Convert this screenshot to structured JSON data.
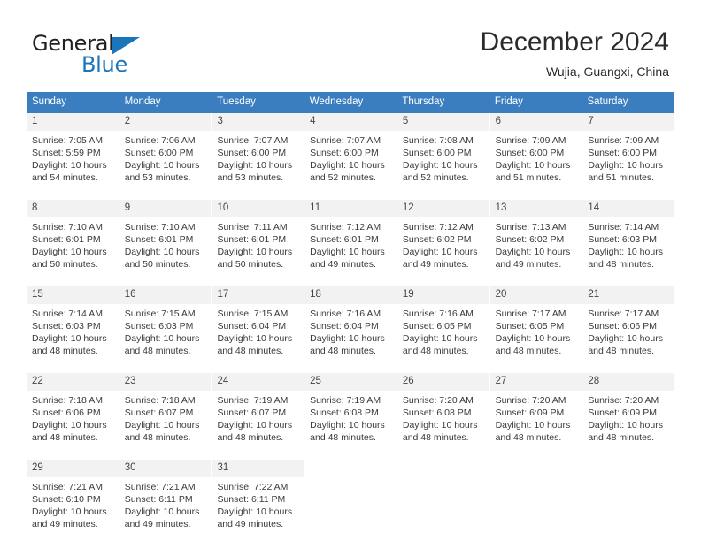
{
  "logo": {
    "text_primary": "General",
    "text_secondary": "Blue",
    "triangle_color": "#1b75bb"
  },
  "header": {
    "title": "December 2024",
    "subtitle": "Wujia, Guangxi, China"
  },
  "theme": {
    "header_band": "#3b7ec0",
    "day_number_bg": "#f2f2f2",
    "text": "#3a3a3a"
  },
  "weekdays": [
    "Sunday",
    "Monday",
    "Tuesday",
    "Wednesday",
    "Thursday",
    "Friday",
    "Saturday"
  ],
  "weeks": [
    [
      {
        "day": "1",
        "sunrise": "Sunrise: 7:05 AM",
        "sunset": "Sunset: 5:59 PM",
        "daylight": "Daylight: 10 hours and 54 minutes."
      },
      {
        "day": "2",
        "sunrise": "Sunrise: 7:06 AM",
        "sunset": "Sunset: 6:00 PM",
        "daylight": "Daylight: 10 hours and 53 minutes."
      },
      {
        "day": "3",
        "sunrise": "Sunrise: 7:07 AM",
        "sunset": "Sunset: 6:00 PM",
        "daylight": "Daylight: 10 hours and 53 minutes."
      },
      {
        "day": "4",
        "sunrise": "Sunrise: 7:07 AM",
        "sunset": "Sunset: 6:00 PM",
        "daylight": "Daylight: 10 hours and 52 minutes."
      },
      {
        "day": "5",
        "sunrise": "Sunrise: 7:08 AM",
        "sunset": "Sunset: 6:00 PM",
        "daylight": "Daylight: 10 hours and 52 minutes."
      },
      {
        "day": "6",
        "sunrise": "Sunrise: 7:09 AM",
        "sunset": "Sunset: 6:00 PM",
        "daylight": "Daylight: 10 hours and 51 minutes."
      },
      {
        "day": "7",
        "sunrise": "Sunrise: 7:09 AM",
        "sunset": "Sunset: 6:00 PM",
        "daylight": "Daylight: 10 hours and 51 minutes."
      }
    ],
    [
      {
        "day": "8",
        "sunrise": "Sunrise: 7:10 AM",
        "sunset": "Sunset: 6:01 PM",
        "daylight": "Daylight: 10 hours and 50 minutes."
      },
      {
        "day": "9",
        "sunrise": "Sunrise: 7:10 AM",
        "sunset": "Sunset: 6:01 PM",
        "daylight": "Daylight: 10 hours and 50 minutes."
      },
      {
        "day": "10",
        "sunrise": "Sunrise: 7:11 AM",
        "sunset": "Sunset: 6:01 PM",
        "daylight": "Daylight: 10 hours and 50 minutes."
      },
      {
        "day": "11",
        "sunrise": "Sunrise: 7:12 AM",
        "sunset": "Sunset: 6:01 PM",
        "daylight": "Daylight: 10 hours and 49 minutes."
      },
      {
        "day": "12",
        "sunrise": "Sunrise: 7:12 AM",
        "sunset": "Sunset: 6:02 PM",
        "daylight": "Daylight: 10 hours and 49 minutes."
      },
      {
        "day": "13",
        "sunrise": "Sunrise: 7:13 AM",
        "sunset": "Sunset: 6:02 PM",
        "daylight": "Daylight: 10 hours and 49 minutes."
      },
      {
        "day": "14",
        "sunrise": "Sunrise: 7:14 AM",
        "sunset": "Sunset: 6:03 PM",
        "daylight": "Daylight: 10 hours and 48 minutes."
      }
    ],
    [
      {
        "day": "15",
        "sunrise": "Sunrise: 7:14 AM",
        "sunset": "Sunset: 6:03 PM",
        "daylight": "Daylight: 10 hours and 48 minutes."
      },
      {
        "day": "16",
        "sunrise": "Sunrise: 7:15 AM",
        "sunset": "Sunset: 6:03 PM",
        "daylight": "Daylight: 10 hours and 48 minutes."
      },
      {
        "day": "17",
        "sunrise": "Sunrise: 7:15 AM",
        "sunset": "Sunset: 6:04 PM",
        "daylight": "Daylight: 10 hours and 48 minutes."
      },
      {
        "day": "18",
        "sunrise": "Sunrise: 7:16 AM",
        "sunset": "Sunset: 6:04 PM",
        "daylight": "Daylight: 10 hours and 48 minutes."
      },
      {
        "day": "19",
        "sunrise": "Sunrise: 7:16 AM",
        "sunset": "Sunset: 6:05 PM",
        "daylight": "Daylight: 10 hours and 48 minutes."
      },
      {
        "day": "20",
        "sunrise": "Sunrise: 7:17 AM",
        "sunset": "Sunset: 6:05 PM",
        "daylight": "Daylight: 10 hours and 48 minutes."
      },
      {
        "day": "21",
        "sunrise": "Sunrise: 7:17 AM",
        "sunset": "Sunset: 6:06 PM",
        "daylight": "Daylight: 10 hours and 48 minutes."
      }
    ],
    [
      {
        "day": "22",
        "sunrise": "Sunrise: 7:18 AM",
        "sunset": "Sunset: 6:06 PM",
        "daylight": "Daylight: 10 hours and 48 minutes."
      },
      {
        "day": "23",
        "sunrise": "Sunrise: 7:18 AM",
        "sunset": "Sunset: 6:07 PM",
        "daylight": "Daylight: 10 hours and 48 minutes."
      },
      {
        "day": "24",
        "sunrise": "Sunrise: 7:19 AM",
        "sunset": "Sunset: 6:07 PM",
        "daylight": "Daylight: 10 hours and 48 minutes."
      },
      {
        "day": "25",
        "sunrise": "Sunrise: 7:19 AM",
        "sunset": "Sunset: 6:08 PM",
        "daylight": "Daylight: 10 hours and 48 minutes."
      },
      {
        "day": "26",
        "sunrise": "Sunrise: 7:20 AM",
        "sunset": "Sunset: 6:08 PM",
        "daylight": "Daylight: 10 hours and 48 minutes."
      },
      {
        "day": "27",
        "sunrise": "Sunrise: 7:20 AM",
        "sunset": "Sunset: 6:09 PM",
        "daylight": "Daylight: 10 hours and 48 minutes."
      },
      {
        "day": "28",
        "sunrise": "Sunrise: 7:20 AM",
        "sunset": "Sunset: 6:09 PM",
        "daylight": "Daylight: 10 hours and 48 minutes."
      }
    ],
    [
      {
        "day": "29",
        "sunrise": "Sunrise: 7:21 AM",
        "sunset": "Sunset: 6:10 PM",
        "daylight": "Daylight: 10 hours and 49 minutes."
      },
      {
        "day": "30",
        "sunrise": "Sunrise: 7:21 AM",
        "sunset": "Sunset: 6:11 PM",
        "daylight": "Daylight: 10 hours and 49 minutes."
      },
      {
        "day": "31",
        "sunrise": "Sunrise: 7:22 AM",
        "sunset": "Sunset: 6:11 PM",
        "daylight": "Daylight: 10 hours and 49 minutes."
      },
      {
        "day": "",
        "sunrise": "",
        "sunset": "",
        "daylight": ""
      },
      {
        "day": "",
        "sunrise": "",
        "sunset": "",
        "daylight": ""
      },
      {
        "day": "",
        "sunrise": "",
        "sunset": "",
        "daylight": ""
      },
      {
        "day": "",
        "sunrise": "",
        "sunset": "",
        "daylight": ""
      }
    ]
  ]
}
